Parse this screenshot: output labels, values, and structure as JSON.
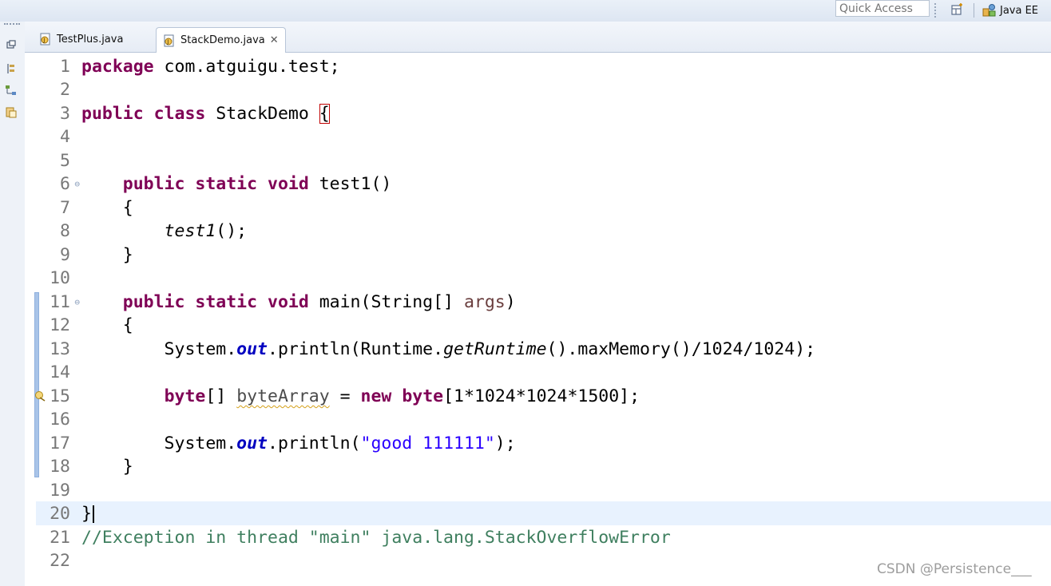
{
  "toolbar": {
    "quick_access_placeholder": "Quick Access",
    "perspective_label": "Java EE"
  },
  "tabs": [
    {
      "label": "TestPlus.java",
      "active": false
    },
    {
      "label": "StackDemo.java",
      "active": true,
      "close_glyph": "✕"
    }
  ],
  "editor": {
    "lines": [
      {
        "num": "1"
      },
      {
        "num": "2"
      },
      {
        "num": "3"
      },
      {
        "num": "4"
      },
      {
        "num": "5"
      },
      {
        "num": "6"
      },
      {
        "num": "7"
      },
      {
        "num": "8"
      },
      {
        "num": "9"
      },
      {
        "num": "10"
      },
      {
        "num": "11"
      },
      {
        "num": "12"
      },
      {
        "num": "13"
      },
      {
        "num": "14"
      },
      {
        "num": "15"
      },
      {
        "num": "16"
      },
      {
        "num": "17"
      },
      {
        "num": "18"
      },
      {
        "num": "19"
      },
      {
        "num": "20"
      },
      {
        "num": "21"
      },
      {
        "num": "22"
      }
    ],
    "tokens": {
      "l1_kw": "package",
      "l1_rest": " com.atguigu.test;",
      "l3_kw1": "public",
      "l3_kw2": "class",
      "l3_name": " StackDemo ",
      "l3_brace": "{",
      "l6_kw": "    public static void",
      "l6_rest": " test1()",
      "l7": "    {",
      "l8_indent": "        ",
      "l8_call": "test1",
      "l8_rest": "();",
      "l9": "    }",
      "l11_kw": "    public static void",
      "l11_mid": " main(String[] ",
      "l11_param": "args",
      "l11_end": ")",
      "l12": "    {",
      "l13_a": "        System.",
      "l13_field": "out",
      "l13_b": ".println(Runtime.",
      "l13_smeth": "getRuntime",
      "l13_c": "().maxMemory()/1024/1024);",
      "l15_indent": "        ",
      "l15_kw1": "byte",
      "l15_a": "[] ",
      "l15_var": "byteArray",
      "l15_b": " = ",
      "l15_kw2": "new",
      "l15_c": " ",
      "l15_kw3": "byte",
      "l15_d": "[1*1024*1024*1500];",
      "l17_a": "        System.",
      "l17_field": "out",
      "l17_b": ".println(",
      "l17_str": "\"good 111111\"",
      "l17_c": ");",
      "l18": "    }",
      "l20": "}",
      "l21_cmt": "//Exception in thread \"main\" java.lang.StackOverflowError"
    },
    "colors": {
      "keyword": "#7f0055",
      "field": "#0000c0",
      "string": "#2a00ff",
      "comment": "#3f7f5f",
      "line_number": "#787878",
      "current_line": "#e8f2fe"
    }
  },
  "watermark": "CSDN @Persistence___",
  "icons": {
    "trim": [
      "restore-icon",
      "package-explorer-icon",
      "type-hierarchy-icon",
      "outline-icon"
    ],
    "perspective": [
      "open-perspective-icon",
      "java-ee-perspective-icon"
    ],
    "tab": "java-file-icon",
    "gutter": [
      "fold-collapse-icon",
      "warning-icon"
    ]
  }
}
